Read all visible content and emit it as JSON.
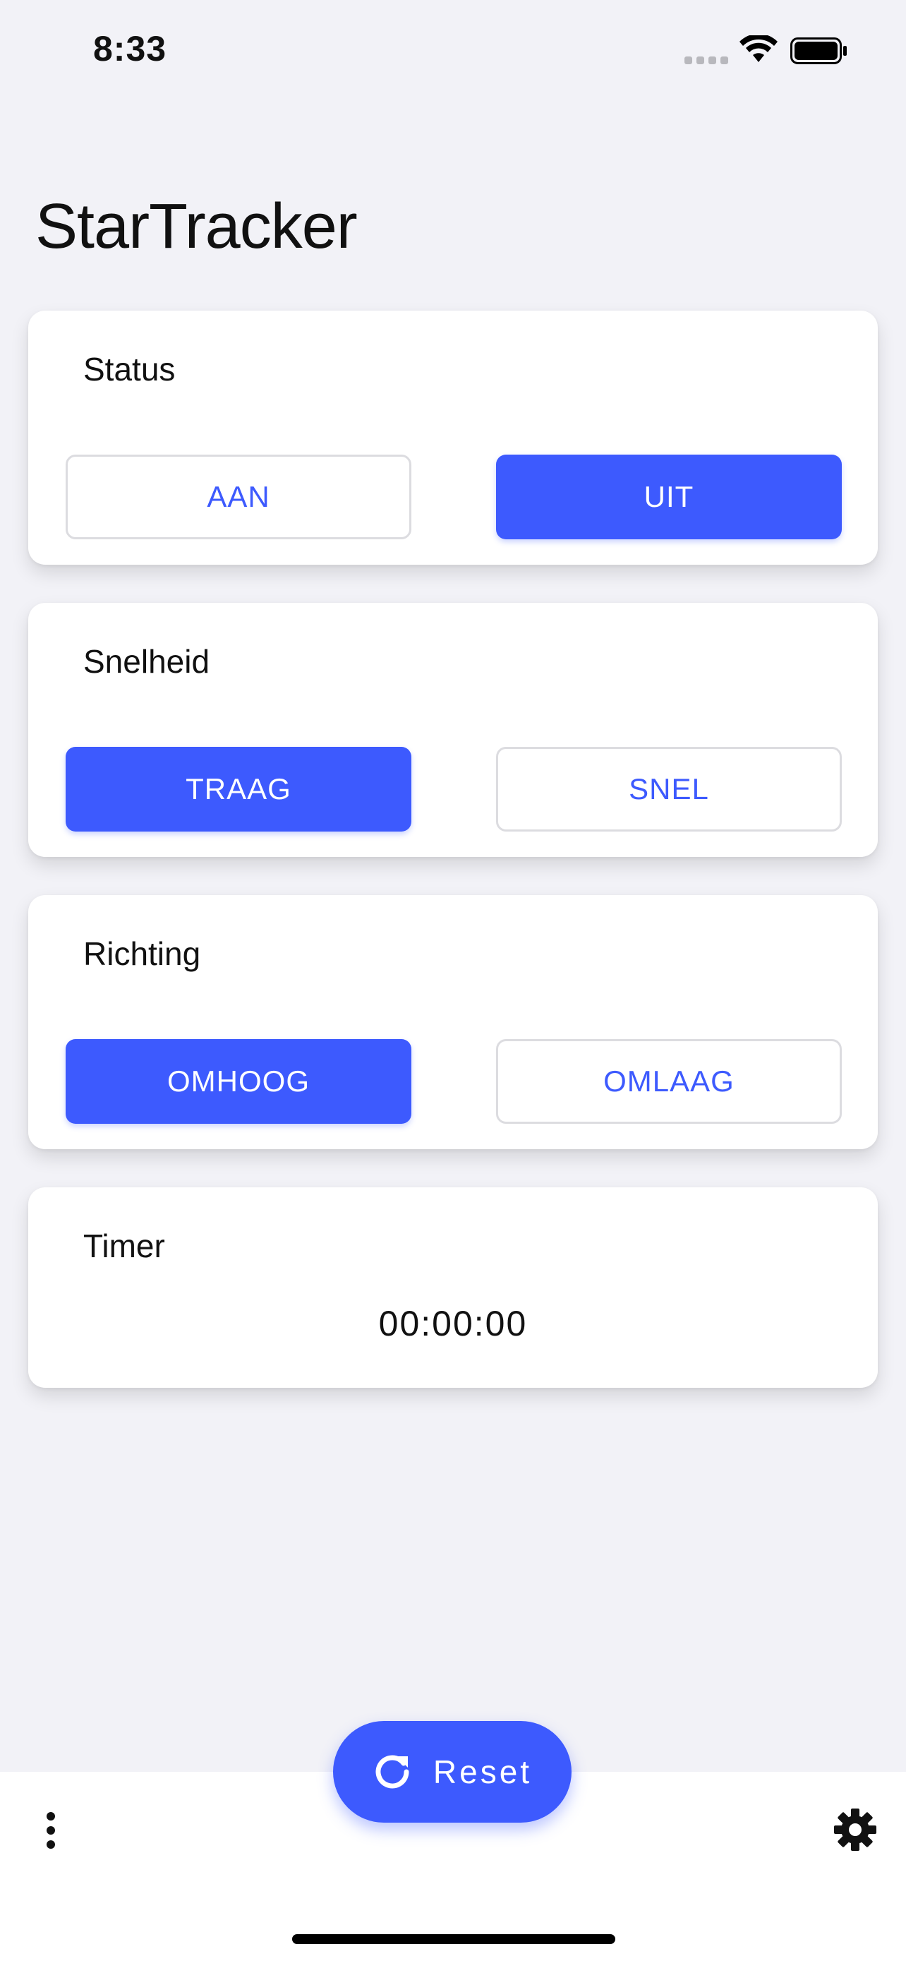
{
  "status_bar": {
    "time": "8:33"
  },
  "app": {
    "title": "StarTracker"
  },
  "cards": {
    "status": {
      "title": "Status",
      "left": "AAN",
      "right": "UIT",
      "selected": "UIT"
    },
    "snelheid": {
      "title": "Snelheid",
      "left": "TRAAG",
      "right": "SNEL",
      "selected": "TRAAG"
    },
    "richting": {
      "title": "Richting",
      "left": "OMHOOG",
      "right": "OMLAAG",
      "selected": "OMHOOG"
    },
    "timer": {
      "title": "Timer",
      "value": "00:00:00"
    }
  },
  "bottom": {
    "reset_label": "Reset"
  },
  "icons": [
    "refresh-icon",
    "more-vertical-icon",
    "gear-icon",
    "wifi-icon",
    "battery-icon",
    "signal-icon"
  ],
  "colors": {
    "accent": "#3d5afe",
    "background": "#f2f2f7"
  }
}
